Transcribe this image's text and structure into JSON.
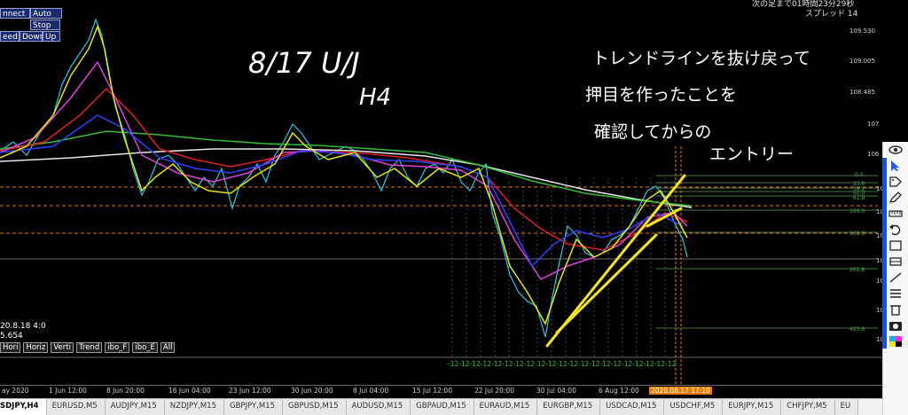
{
  "window": {
    "controls_row1": [
      "nnect",
      "Auto"
    ],
    "controls_row2": [
      "Stop",
      "Auto"
    ],
    "controls_row3": [
      "eed:",
      "Down",
      "Up"
    ]
  },
  "timer": {
    "line1": "次の足まで01時間23分29秒",
    "line2": "スプレッド 14"
  },
  "annotations": {
    "pair": "8/17  U/J",
    "timeframe": "H4",
    "note_line1": "トレンドラインを抜け戻って",
    "note_line2": "押目を作ったことを",
    "note_line3": "確認してからの",
    "note_line4": "エントリー"
  },
  "info": {
    "date": "20.8.18 4:0",
    "price": "5.654",
    "buttons": [
      "Hori",
      "Horiz",
      "Verti",
      "Trend",
      "ibo_F",
      "ibo_E",
      "All"
    ]
  },
  "price_axis": {
    "labels": [
      "109.530",
      "109.005",
      "108.485",
      "107",
      "106",
      "106",
      "106",
      "106",
      "105",
      "105",
      "104",
      "104"
    ],
    "fib_labels": [
      "0.0",
      "23.6",
      "38.2",
      "50.0",
      "61.8",
      "100.0",
      "161.8",
      "261.8",
      "423.6"
    ]
  },
  "time_axis": {
    "labels": [
      "ay 2020",
      "1 Jun 12:00",
      "8 Jun 20:00",
      "16 Jun 04:00",
      "23 Jun 12:00",
      "30 Jun 20:00",
      "8 Jul 04:00",
      "15 Jul 12:00",
      "22 Jul 20:00",
      "30 Jul 04:00",
      "6 Aug 12:00",
      "2020.08.17 17:10"
    ],
    "ticks_label": "-12-12-12-12-12-12-12-12-12-12-12-12-12-12-12-12-12-12-12-12-12"
  },
  "tabs": [
    "SDJPY,H4",
    "EURUSD,M5",
    "AUDJPY,M15",
    "NZDJPY,M15",
    "GBPJPY,M15",
    "GBPUSD,M15",
    "AUDUSD,M15",
    "GBPAUD,M15",
    "EURAUD,M15",
    "EURGBP,M15",
    "USDCAD,M15",
    "USDCHF,M5",
    "EURJPY,M15",
    "CHFJPY,M5",
    "EU"
  ],
  "toolbar": {
    "icons": [
      "eye-icon",
      "cursor-icon",
      "tag-icon",
      "pen-icon",
      "ruler-icon",
      "undo-icon",
      "rect-icon",
      "rect-icon",
      "line-icon",
      "list-icon",
      "trash-icon",
      "camera-icon",
      "palette-icon"
    ]
  },
  "colors": {
    "accent_orange": "#e67e00",
    "trend_yellow": "#f5e61a",
    "ma_white": "#e8e8e8",
    "ma_green": "#2fbf2f",
    "ma_red": "#e02020",
    "ma_magenta": "#e040e0",
    "ma_blue": "#3040ff"
  }
}
